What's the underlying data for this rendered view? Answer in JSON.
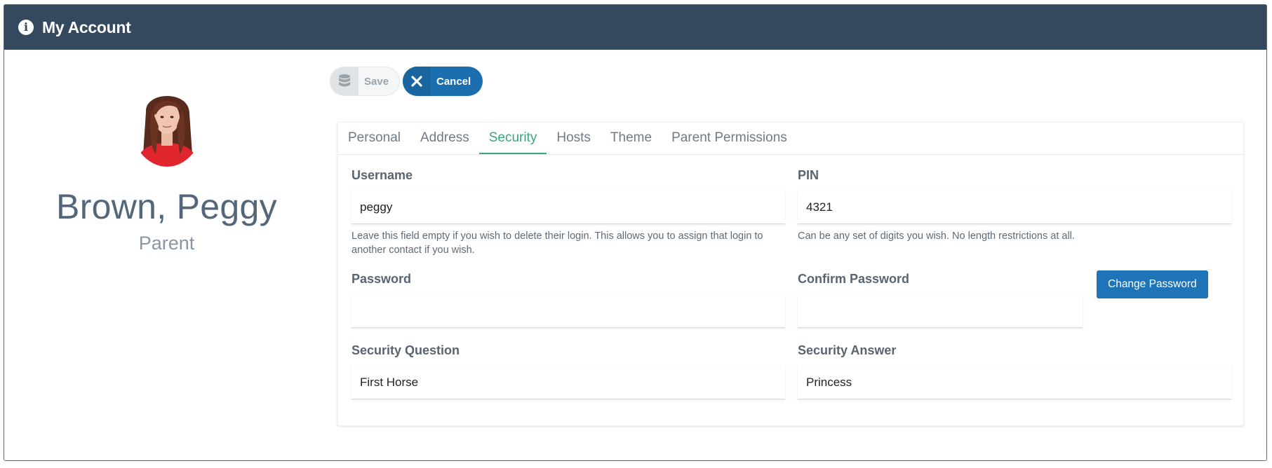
{
  "header": {
    "title": "My Account",
    "icon": "info-circle-icon"
  },
  "profile": {
    "name": "Brown, Peggy",
    "role": "Parent"
  },
  "toolbar": {
    "save_label": "Save",
    "cancel_label": "Cancel"
  },
  "tabs": [
    {
      "label": "Personal",
      "active": false
    },
    {
      "label": "Address",
      "active": false
    },
    {
      "label": "Security",
      "active": true
    },
    {
      "label": "Hosts",
      "active": false
    },
    {
      "label": "Theme",
      "active": false
    },
    {
      "label": "Parent Permissions",
      "active": false
    }
  ],
  "security": {
    "username": {
      "label": "Username",
      "value": "peggy",
      "help": "Leave this field empty if you wish to delete their login. This allows you to assign that login to another contact if you wish."
    },
    "pin": {
      "label": "PIN",
      "value": "4321",
      "help": "Can be any set of digits you wish. No length restrictions at all."
    },
    "password": {
      "label": "Password",
      "value": ""
    },
    "confirm_password": {
      "label": "Confirm Password",
      "value": ""
    },
    "change_password_label": "Change Password",
    "security_question": {
      "label": "Security Question",
      "value": "First Horse"
    },
    "security_answer": {
      "label": "Security Answer",
      "value": "Princess"
    }
  },
  "colors": {
    "header_bg": "#34495e",
    "accent_tab": "#3aa57f",
    "primary_button": "#1b6fae"
  }
}
